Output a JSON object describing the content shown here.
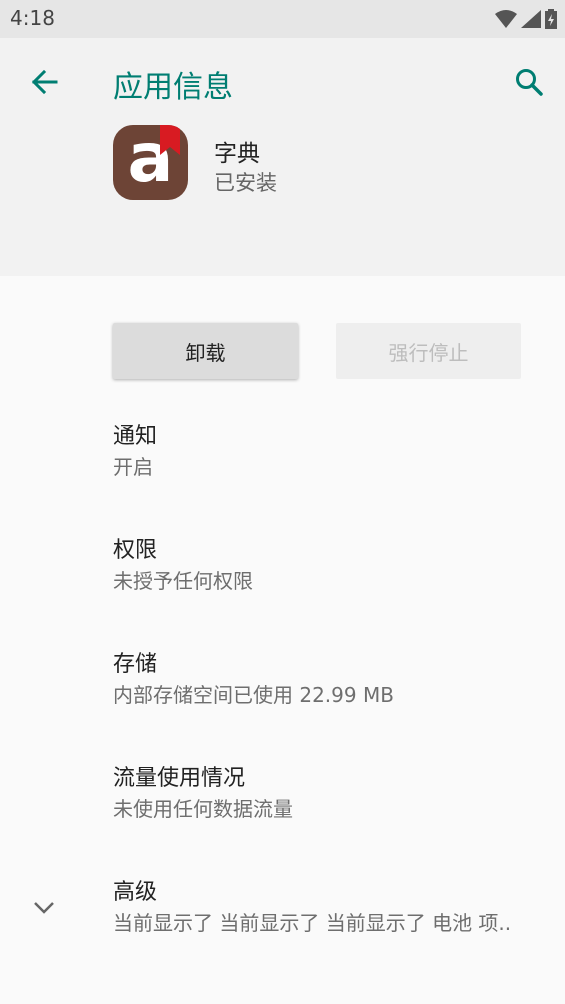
{
  "status_bar": {
    "time": "4:18"
  },
  "header": {
    "title": "应用信息"
  },
  "app": {
    "name": "字典",
    "status": "已安装",
    "icon_letter": "a"
  },
  "actions": {
    "uninstall_label": "卸载",
    "force_stop_label": "强行停止"
  },
  "settings": [
    {
      "title": "通知",
      "subtitle": "开启"
    },
    {
      "title": "权限",
      "subtitle": "未授予任何权限"
    },
    {
      "title": "存储",
      "subtitle": "内部存储空间已使用 22.99 MB"
    },
    {
      "title": "流量使用情况",
      "subtitle": "未使用任何数据流量"
    },
    {
      "title": "高级",
      "subtitle": "当前显示了 当前显示了 当前显示了 电池 项.."
    }
  ],
  "colors": {
    "accent": "#007e72",
    "icon_bg": "#6d4436",
    "bookmark": "#d81b22"
  }
}
